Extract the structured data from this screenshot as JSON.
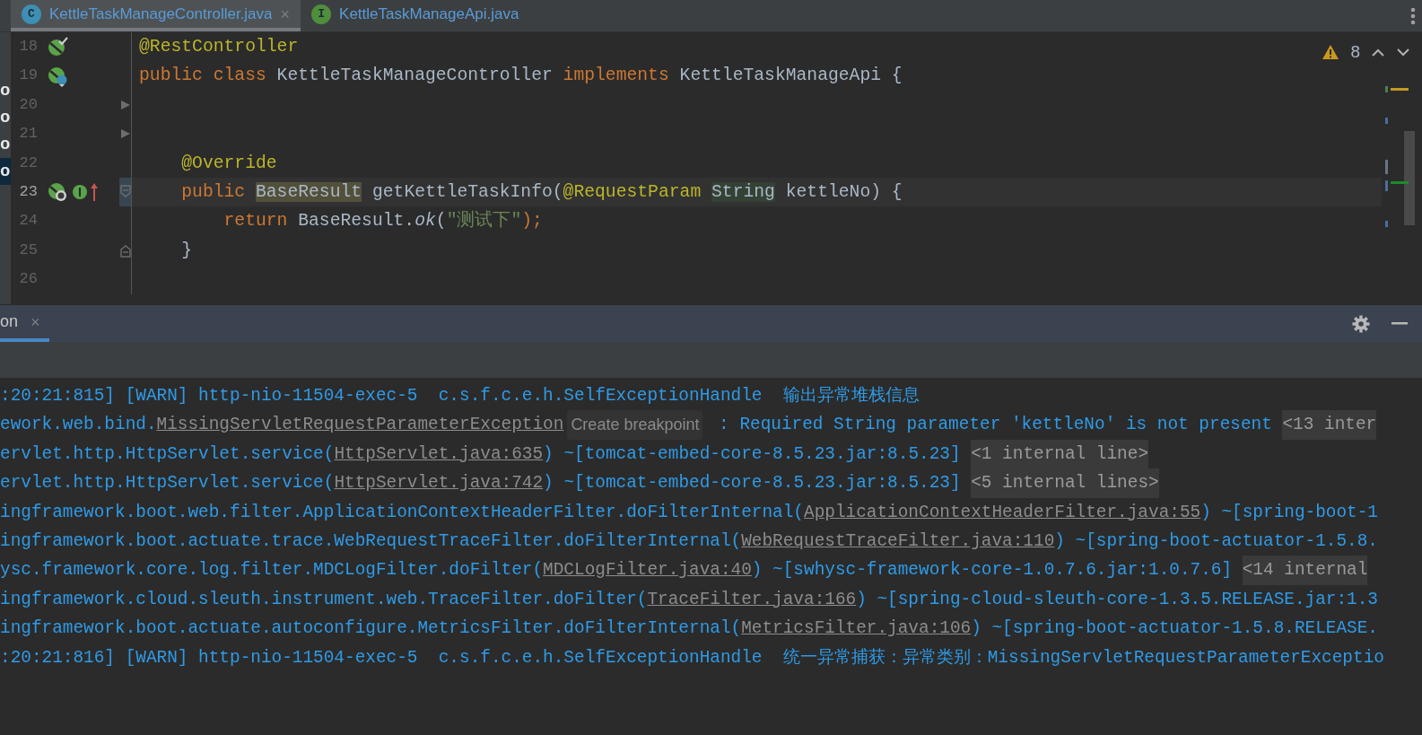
{
  "editor_tabs": [
    {
      "badge": "C",
      "kind": "class",
      "label": "KettleTaskManageController.java",
      "selected": true,
      "close": "×"
    },
    {
      "badge": "I",
      "kind": "interface",
      "label": "KettleTaskManageApi.java",
      "selected": false
    }
  ],
  "left_panel_fragments": [
    {
      "text": "o",
      "selected": false
    },
    {
      "text": "o",
      "selected": false
    },
    {
      "text": "o",
      "selected": false
    },
    {
      "text": "o",
      "selected": true
    }
  ],
  "inspections": {
    "count": "8"
  },
  "code_lines": [
    {
      "number": "18",
      "current": false,
      "markers": [
        {
          "kind": "bean-check"
        }
      ],
      "tokens": [
        {
          "kind": "annotation",
          "text": "@RestController"
        }
      ]
    },
    {
      "number": "19",
      "current": false,
      "markers": [
        {
          "kind": "bean-class"
        }
      ],
      "tokens": [
        {
          "kind": "keyword",
          "text": "public class "
        },
        {
          "kind": "plain",
          "text": "KettleTaskManageController "
        },
        {
          "kind": "keyword",
          "text": "implements "
        },
        {
          "kind": "plain",
          "text": "KettleTaskManageApi {"
        }
      ]
    },
    {
      "number": "20",
      "current": false,
      "fold": {
        "kind": "collapsed"
      }
    },
    {
      "number": "21",
      "current": false,
      "fold": {
        "kind": "collapsed"
      }
    },
    {
      "number": "22",
      "current": false,
      "tokens": [
        {
          "kind": "annotation",
          "text": "    @Override"
        }
      ]
    },
    {
      "number": "23",
      "current": true,
      "fold": {
        "kind": "start"
      },
      "markers": [
        {
          "kind": "bean-web"
        },
        {
          "kind": "implements"
        },
        {
          "kind": "override-arrow"
        }
      ],
      "tokens": [
        {
          "kind": "keyword",
          "text": "    public "
        },
        {
          "kind": "usage",
          "text": "BaseResult"
        },
        {
          "kind": "plain",
          "text": " getKettleTaskInfo("
        },
        {
          "kind": "annotation",
          "text": "@RequestParam "
        },
        {
          "kind": "read",
          "text": "String"
        },
        {
          "kind": "plain",
          "text": " kettleNo) {"
        }
      ]
    },
    {
      "number": "24",
      "current": false,
      "tokens": [
        {
          "kind": "keyword",
          "text": "        return "
        },
        {
          "kind": "plain",
          "text": "BaseResult."
        },
        {
          "kind": "static",
          "text": "ok"
        },
        {
          "kind": "plain",
          "text": "("
        },
        {
          "kind": "string",
          "text": "\"测试下\""
        },
        {
          "kind": "keyword",
          "text": ");"
        }
      ]
    },
    {
      "number": "25",
      "current": false,
      "fold": {
        "kind": "end"
      },
      "tokens": [
        {
          "kind": "plain",
          "text": "    }"
        }
      ]
    },
    {
      "number": "26",
      "current": false
    }
  ],
  "console_tabs": [
    {
      "label": "on",
      "selected": true,
      "close": "×"
    }
  ],
  "console_lines": [
    [
      {
        "kind": "text",
        "text": ":20:21:815] [WARN] http-nio-11504-exec-5  c.s.f.c.e.h.SelfExceptionHandle  输出异常堆栈信息"
      }
    ],
    [
      {
        "kind": "text",
        "text": "ework.web.bind."
      },
      {
        "kind": "link",
        "text": "MissingServletRequestParameterException"
      },
      {
        "kind": "hint",
        "text": "Create breakpoint"
      },
      {
        "kind": "text",
        "text": " : Required String parameter 'kettleNo' is not present "
      },
      {
        "kind": "fold",
        "text": "<13 inter"
      }
    ],
    [
      {
        "kind": "text",
        "text": "ervlet.http.HttpServlet.service("
      },
      {
        "kind": "link",
        "text": "HttpServlet.java:635"
      },
      {
        "kind": "text",
        "text": ") ~[tomcat-embed-core-8.5.23.jar:8.5.23] "
      },
      {
        "kind": "fold",
        "text": "<1 internal line>"
      }
    ],
    [
      {
        "kind": "text",
        "text": "ervlet.http.HttpServlet.service("
      },
      {
        "kind": "link",
        "text": "HttpServlet.java:742"
      },
      {
        "kind": "text",
        "text": ") ~[tomcat-embed-core-8.5.23.jar:8.5.23] "
      },
      {
        "kind": "fold",
        "text": "<5 internal lines>"
      }
    ],
    [
      {
        "kind": "text",
        "text": "ingframework.boot.web.filter.ApplicationContextHeaderFilter.doFilterInternal("
      },
      {
        "kind": "link",
        "text": "ApplicationContextHeaderFilter.java:55"
      },
      {
        "kind": "text",
        "text": ") ~[spring-boot-1"
      }
    ],
    [
      {
        "kind": "text",
        "text": "ingframework.boot.actuate.trace.WebRequestTraceFilter.doFilterInternal("
      },
      {
        "kind": "link",
        "text": "WebRequestTraceFilter.java:110"
      },
      {
        "kind": "text",
        "text": ") ~[spring-boot-actuator-1.5.8."
      }
    ],
    [
      {
        "kind": "text",
        "text": "ysc.framework.core.log.filter.MDCLogFilter.doFilter("
      },
      {
        "kind": "link",
        "text": "MDCLogFilter.java:40"
      },
      {
        "kind": "text",
        "text": ") ~[swhysc-framework-core-1.0.7.6.jar:1.0.7.6] "
      },
      {
        "kind": "fold",
        "text": "<14 internal"
      }
    ],
    [
      {
        "kind": "text",
        "text": "ingframework.cloud.sleuth.instrument.web.TraceFilter.doFilter("
      },
      {
        "kind": "link",
        "text": "TraceFilter.java:166"
      },
      {
        "kind": "text",
        "text": ") ~[spring-cloud-sleuth-core-1.3.5.RELEASE.jar:1.3"
      }
    ],
    [
      {
        "kind": "text",
        "text": "ingframework.boot.actuate.autoconfigure.MetricsFilter.doFilterInternal("
      },
      {
        "kind": "link",
        "text": "MetricsFilter.java:106"
      },
      {
        "kind": "text",
        "text": ") ~[spring-boot-actuator-1.5.8.RELEASE."
      }
    ],
    [
      {
        "kind": "text",
        "text": ":20:21:816] [WARN] http-nio-11504-exec-5  c.s.f.c.e.h.SelfExceptionHandle  统一异常捕获：异常类别：MissingServletRequestParameterExceptio"
      }
    ]
  ]
}
